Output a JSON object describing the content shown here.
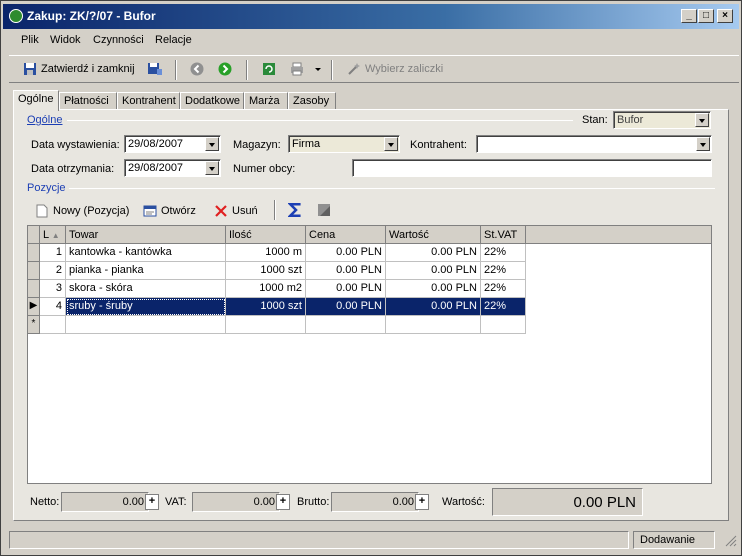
{
  "window": {
    "title": "Zakup: ZK/?/07 - Bufor"
  },
  "menu": [
    "Plik",
    "Widok",
    "Czynności",
    "Relacje"
  ],
  "toolbar": {
    "confirm_close": "Zatwierdź i zamknij",
    "choose_advances": "Wybierz zaliczki"
  },
  "tabs": [
    "Ogólne",
    "Płatności",
    "Kontrahent",
    "Dodatkowe",
    "Marża",
    "Zasoby"
  ],
  "general": {
    "group_label": "Ogólne",
    "stan_label": "Stan:",
    "stan_value": "Bufor",
    "issue_date_label": "Data wystawienia:",
    "issue_date_value": "29/08/2007",
    "receipt_date_label": "Data otrzymania:",
    "receipt_date_value": "29/08/2007",
    "warehouse_label": "Magazyn:",
    "warehouse_value": "Firma",
    "contractor_label": "Kontrahent:",
    "contractor_value": "",
    "foreign_number_label": "Numer obcy:",
    "foreign_number_value": ""
  },
  "positions": {
    "group_label": "Pozycje",
    "new_label": "Nowy (Pozycja)",
    "open_label": "Otwórz",
    "delete_label": "Usuń"
  },
  "grid": {
    "headers": [
      "L",
      "Towar",
      "Ilość",
      "Cena",
      "Wartość",
      "St.VAT"
    ],
    "rows": [
      [
        "1",
        "kantowka - kantówka",
        "1000 m",
        "0.00 PLN",
        "0.00 PLN",
        "22%"
      ],
      [
        "2",
        "pianka - pianka",
        "1000 szt",
        "0.00 PLN",
        "0.00 PLN",
        "22%"
      ],
      [
        "3",
        "skora - skóra",
        "1000 m2",
        "0.00 PLN",
        "0.00 PLN",
        "22%"
      ],
      [
        "4",
        "sruby - śruby",
        "1000 szt",
        "0.00 PLN",
        "0.00 PLN",
        "22%"
      ]
    ],
    "new_row_marker": "*"
  },
  "totals": {
    "netto_label": "Netto:",
    "netto_value": "0.00",
    "vat_label": "VAT:",
    "vat_value": "0.00",
    "brutto_label": "Brutto:",
    "brutto_value": "0.00",
    "wartosc_label": "Wartość:",
    "wartosc_value": "0.00 PLN"
  },
  "status": {
    "mode": "Dodawanie"
  }
}
